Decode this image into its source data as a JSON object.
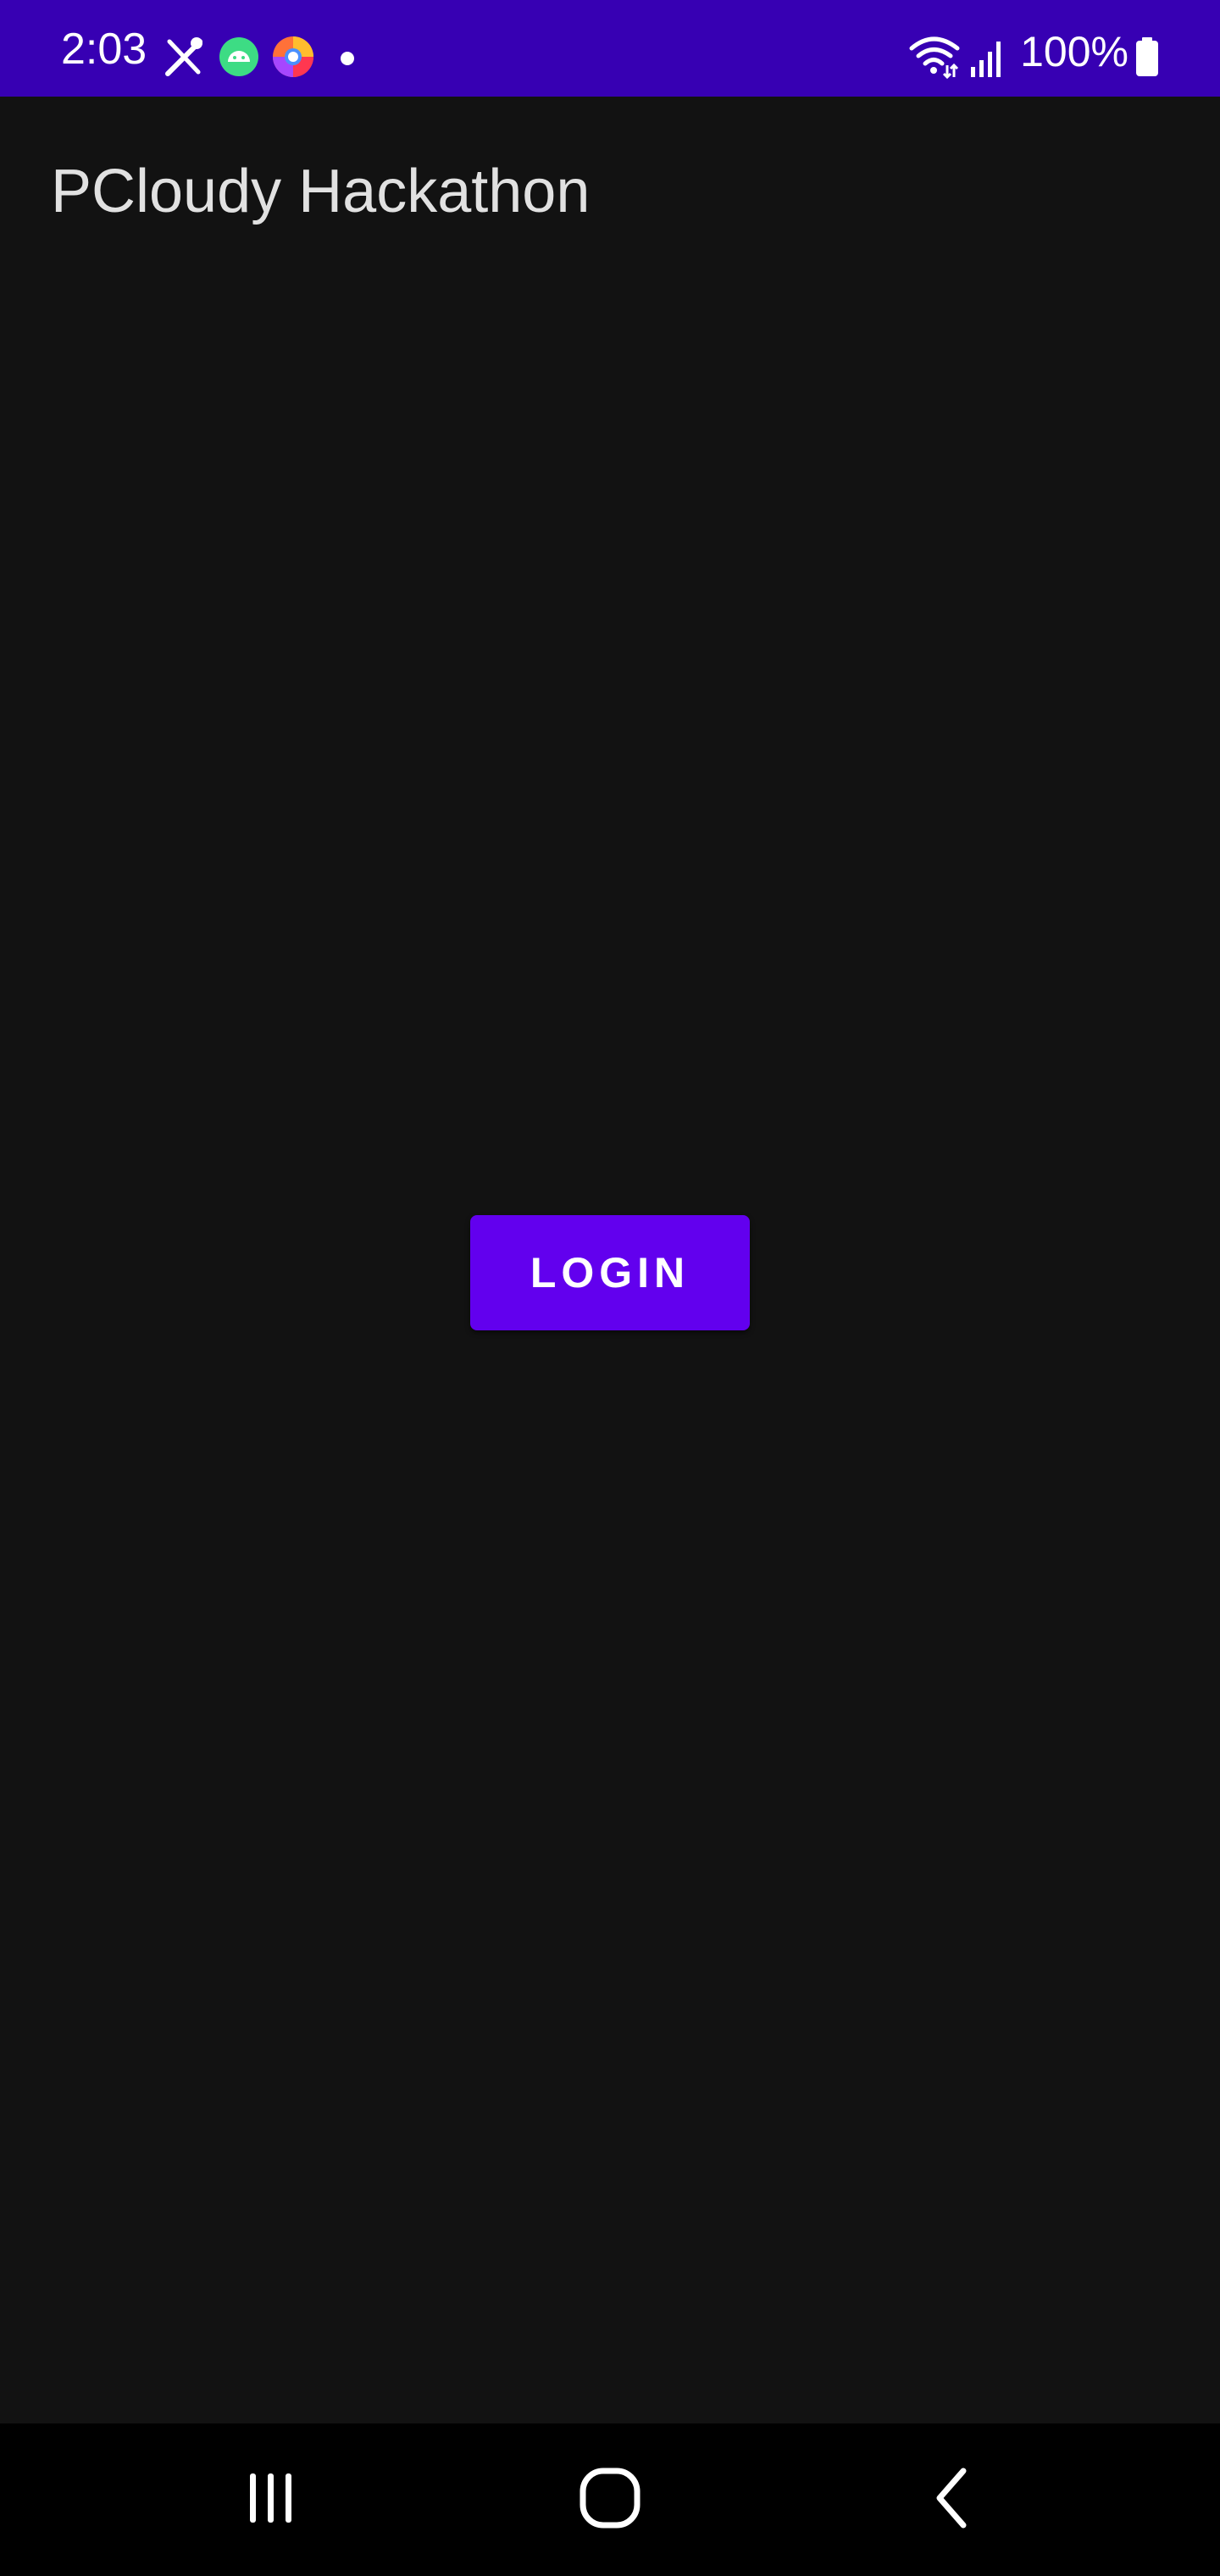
{
  "status_bar": {
    "time": "2:03",
    "battery": "100%",
    "background_color": "#3700B3",
    "notification_icons": [
      "tools-icon",
      "android-icon",
      "browser-icon",
      "dot-icon"
    ],
    "system_icons": [
      "wifi-icon",
      "signal-icon",
      "battery-icon"
    ]
  },
  "app_bar": {
    "title": "PCloudy Hackathon"
  },
  "main": {
    "login_label": "LOGIN",
    "login_button_color": "#6200EE",
    "background_color": "#121212"
  },
  "nav_bar": {
    "buttons": [
      "recent-apps-icon",
      "home-icon",
      "back-icon"
    ]
  }
}
